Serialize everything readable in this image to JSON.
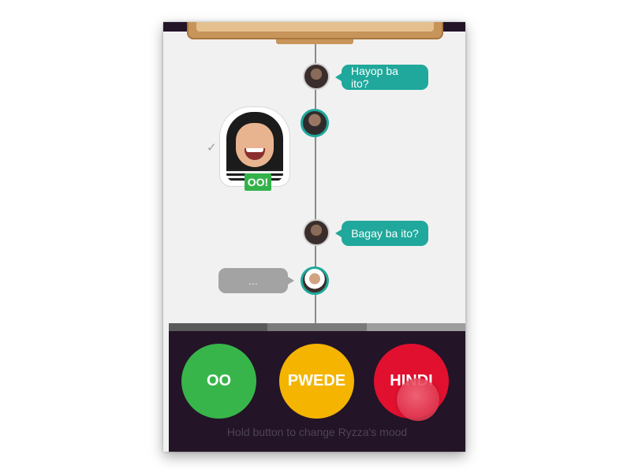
{
  "chat": {
    "messages": [
      {
        "from": "other",
        "text": "Hayop ba ito?"
      },
      {
        "from": "user",
        "sticker_label": "OO!",
        "status_icon": "check-icon"
      },
      {
        "from": "other",
        "text": "Bagay ba ito?"
      },
      {
        "from": "user",
        "typing_text": "..."
      }
    ]
  },
  "progress": {
    "segments": [
      {
        "color": "#5a5a5a"
      },
      {
        "color": "#7a7a7a"
      },
      {
        "color": "#9e9e9e"
      }
    ]
  },
  "controls": {
    "buttons": [
      {
        "label": "OO",
        "color": "#38b54a"
      },
      {
        "label": "PWEDE",
        "color": "#f4b400"
      },
      {
        "label": "HINDI",
        "color": "#e1102f"
      }
    ],
    "hint": "Hold button to change Ryzza's mood"
  },
  "colors": {
    "accent": "#1fa89b",
    "panel": "#231428",
    "background": "#f1f1f1"
  }
}
